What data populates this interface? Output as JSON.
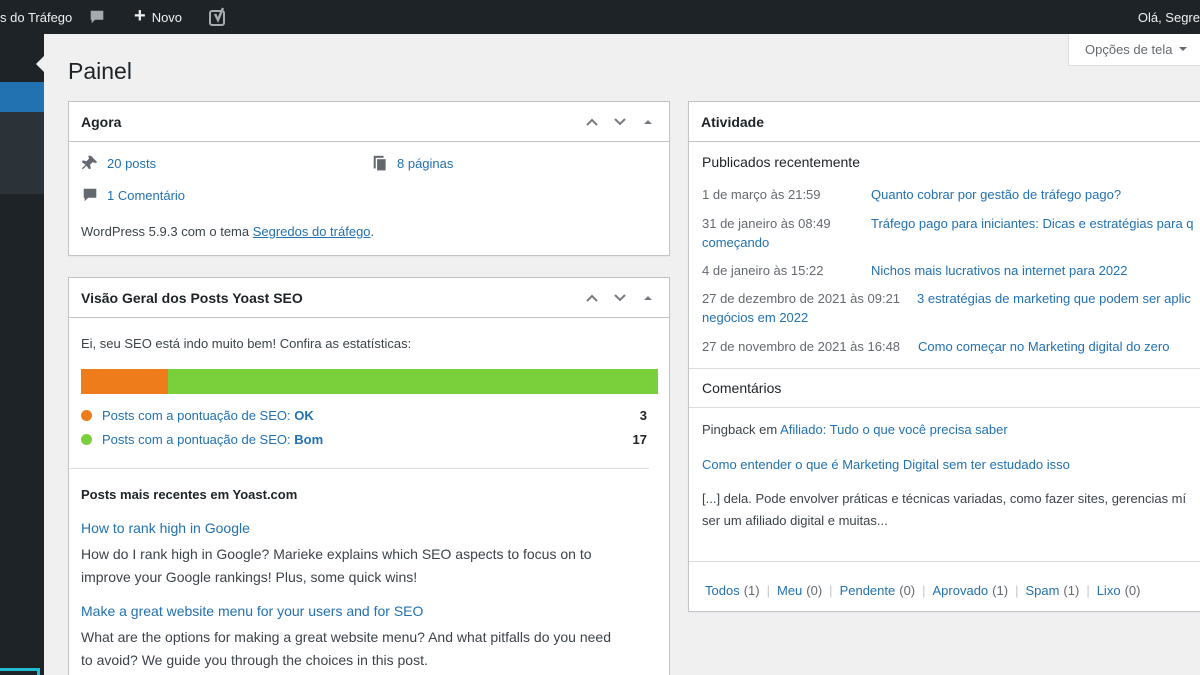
{
  "adminbar": {
    "site_name": "s do Tráfego",
    "new_label": "Novo",
    "howdy": "Olá, Segre"
  },
  "screen_options": {
    "label": "Opções de tela"
  },
  "page": {
    "title": "Painel"
  },
  "agora": {
    "title": "Agora",
    "posts": "20 posts",
    "pages": "8 páginas",
    "comments": "1 Comentário",
    "version_text": "WordPress 5.9.3 com o tema ",
    "theme_link": "Segredos do tráfego",
    "version_end": "."
  },
  "yoast": {
    "title": "Visão Geral dos Posts Yoast SEO",
    "intro": "Ei, seu SEO está indo muito bem! Confira as estatísticas:",
    "bar": {
      "ok_fraction": 0.15,
      "good_fraction": 0.85,
      "ok_color": "#ee7c1b",
      "good_color": "#7ad03a"
    },
    "rows": [
      {
        "label": "Posts com a pontuação de SEO: ",
        "score": "OK",
        "count": "3",
        "color": "#ee7c1b"
      },
      {
        "label": "Posts com a pontuação de SEO: ",
        "score": "Bom",
        "count": "17",
        "color": "#7ad03a"
      }
    ],
    "recent_heading": "Posts mais recentes em Yoast.com",
    "articles": [
      {
        "title": "How to rank high in Google",
        "line1": "How do I rank high in Google? Marieke explains which SEO aspects to focus on to",
        "line2": "improve your Google rankings! Plus, some quick wins!"
      },
      {
        "title": "Make a great website menu for your users and for SEO",
        "line1": "What are the options for making a great website menu? And what pitfalls do you need",
        "line2": "to avoid? We guide you through the choices in this post."
      }
    ]
  },
  "atividade": {
    "title": "Atividade",
    "published_heading": "Publicados recentemente",
    "published": [
      {
        "date": "1 de março às 21:59",
        "title": "Quanto cobrar por gestão de tráfego pago?",
        "cont": ""
      },
      {
        "date": "31 de janeiro às 08:49",
        "title": "Tráfego pago para iniciantes: Dicas e estratégias para q",
        "cont": "começando"
      },
      {
        "date": "4 de janeiro às 15:22",
        "title": "Nichos mais lucrativos na internet para 2022",
        "cont": ""
      },
      {
        "date": "27 de dezembro de 2021 às 09:21",
        "title": "3 estratégias de marketing que podem ser aplic",
        "cont": "negócios em 2022"
      },
      {
        "date": "27 de novembro de 2021 às 16:48",
        "title": "Como começar no Marketing digital do zero",
        "cont": ""
      }
    ],
    "comments_heading": "Comentários",
    "comment": {
      "type": "Pingback",
      "on": " em ",
      "author_link": "Afiliado: Tudo o que você precisa saber",
      "post_link": "Como entender o que é Marketing Digital sem ter estudado isso",
      "excerpt1": "[...] dela. Pode envolver práticas e técnicas variadas, como fazer sites, gerencias mí",
      "excerpt2": "ser um afiliado digital e muitas..."
    },
    "filters": [
      {
        "label": "Todos",
        "count": "(1)"
      },
      {
        "label": "Meu",
        "count": "(0)"
      },
      {
        "label": "Pendente",
        "count": "(0)"
      },
      {
        "label": "Aprovado",
        "count": "(1)"
      },
      {
        "label": "Spam",
        "count": "(1)"
      },
      {
        "label": "Lixo",
        "count": "(0)"
      }
    ]
  },
  "icons": {
    "comment": "comment-bubble-icon",
    "plus": "plus-icon",
    "yoast": "yoast-logo-icon",
    "pin": "pushpin-icon",
    "pages": "pages-icon",
    "caret": "caret-down-icon"
  }
}
